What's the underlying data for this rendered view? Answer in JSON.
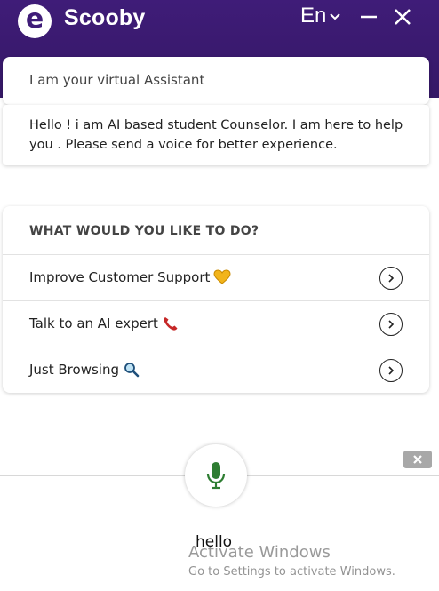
{
  "header": {
    "logo_letter": "e",
    "app_title": "Scooby",
    "language": "En",
    "brand_color": "#3f1c78"
  },
  "intro": {
    "title": "I am your virtual Assistant"
  },
  "message": {
    "text": "Hello ! i am AI based student Counselor. I am here to help you . Please send a voice for better experience."
  },
  "menu": {
    "heading": "WHAT WOULD YOU LIKE TO DO?",
    "items": [
      {
        "label": "Improve Customer Support",
        "icon": "heart-icon"
      },
      {
        "label": "Talk to an AI expert",
        "icon": "phone-icon"
      },
      {
        "label": "Just Browsing",
        "icon": "magnifier-icon"
      }
    ]
  },
  "voice": {
    "transcript": "hello",
    "mic_color": "#2e7d32"
  },
  "watermark": {
    "title": "Activate Windows",
    "subtitle": "Go to Settings to activate Windows."
  }
}
